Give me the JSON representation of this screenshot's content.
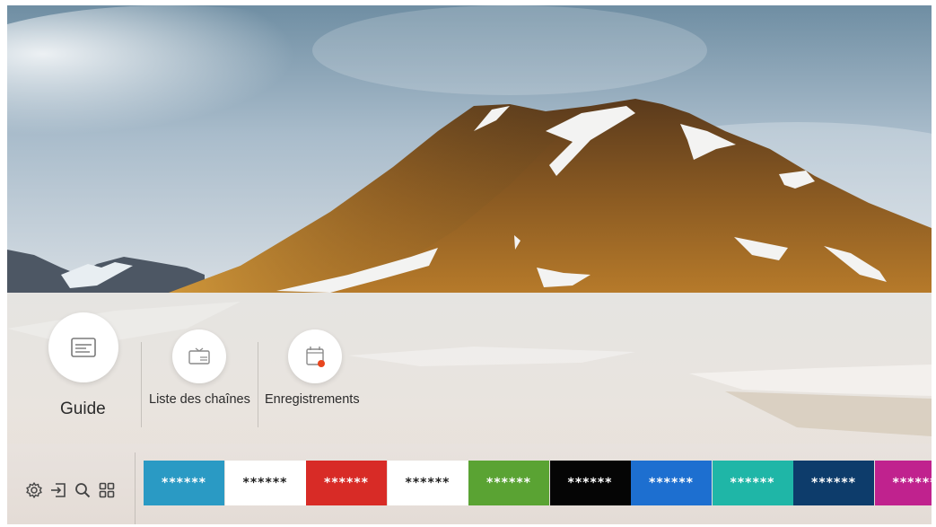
{
  "menu": {
    "guide": {
      "label": "Guide",
      "icon": "guide-icon"
    },
    "channel_list": {
      "label": "Liste des chaînes",
      "icon": "channel-list-icon"
    },
    "recordings": {
      "label": "Enregistrements",
      "icon": "recordings-icon"
    }
  },
  "system_icons": [
    "settings-icon",
    "source-icon",
    "search-icon",
    "apps-icon"
  ],
  "app_tiles": [
    {
      "label": "******",
      "bg": "#2a9ac4",
      "fg": "#ffffff"
    },
    {
      "label": "******",
      "bg": "#ffffff",
      "fg": "#222222"
    },
    {
      "label": "******",
      "bg": "#d82b26",
      "fg": "#ffffff"
    },
    {
      "label": "******",
      "bg": "#ffffff",
      "fg": "#222222"
    },
    {
      "label": "******",
      "bg": "#5aa333",
      "fg": "#ffffff"
    },
    {
      "label": "******",
      "bg": "#050505",
      "fg": "#ffffff"
    },
    {
      "label": "******",
      "bg": "#1d6fd0",
      "fg": "#ffffff"
    },
    {
      "label": "******",
      "bg": "#1fb6a7",
      "fg": "#ffffff"
    },
    {
      "label": "******",
      "bg": "#0d3c6b",
      "fg": "#ffffff"
    },
    {
      "label": "******",
      "bg": "#c0228e",
      "fg": "#ffffff"
    }
  ],
  "colors": {
    "recording_dot": "#e8461e",
    "icon_gray": "#777777"
  }
}
